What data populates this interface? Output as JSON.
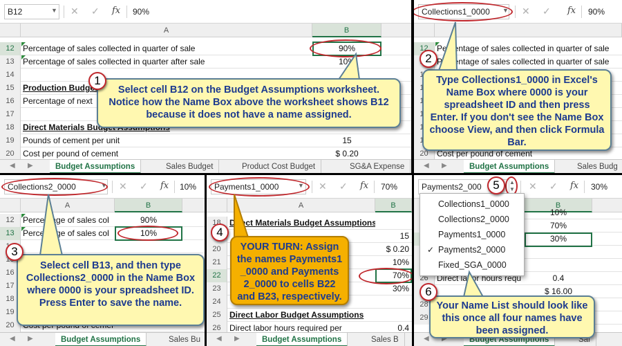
{
  "panel1": {
    "namebox": "B12",
    "formula": "90%",
    "col_a": "A",
    "col_b": "B",
    "rows": [
      {
        "n": "12",
        "a": "Percentage of sales collected in quarter of sale",
        "b": "90%",
        "bold": false
      },
      {
        "n": "13",
        "a": "Percentage of sales collected in quarter after sale",
        "b": "10%",
        "bold": false
      },
      {
        "n": "14",
        "a": "",
        "b": "",
        "bold": false
      },
      {
        "n": "15",
        "a": "Production Budget",
        "b": "",
        "bold": true
      },
      {
        "n": "16",
        "a": "Percentage of next",
        "b": "",
        "bold": false
      },
      {
        "n": "17",
        "a": "",
        "b": "",
        "bold": false
      },
      {
        "n": "18",
        "a": "Direct Materials Budget Assumptions",
        "b": "",
        "bold": true
      },
      {
        "n": "19",
        "a": "Pounds of cement per unit",
        "b": "15",
        "bold": false
      },
      {
        "n": "20",
        "a": "Cost per pound of cement",
        "b": "$         0.20",
        "bold": false
      }
    ],
    "tabs": [
      "Budget Assumptions",
      "Sales Budget",
      "Product Cost Budget",
      "SG&A Expense"
    ],
    "callout_num": "1",
    "callout": "Select cell B12 on the Budget Assumptions worksheet. Notice how the Name Box above the worksheet shows B12 because it does not have a name assigned."
  },
  "panel2": {
    "namebox": "Collections1_0000",
    "formula": "90%",
    "rows": [
      {
        "n": "12",
        "a": "Percentage of sales collected in quarter of sale"
      },
      {
        "n": "13",
        "a": "Percentage of sales collected in quarter of sale"
      },
      {
        "n": "14",
        "a": ""
      },
      {
        "n": "15",
        "a": ""
      },
      {
        "n": "16",
        "a": ""
      },
      {
        "n": "17",
        "a": ""
      },
      {
        "n": "18",
        "a": ""
      },
      {
        "n": "19",
        "a": ""
      },
      {
        "n": "20",
        "a": "Cost per pound of cement"
      }
    ],
    "tabs": [
      "Budget Assumptions",
      "Sales Budg"
    ],
    "callout_num": "2",
    "callout": "Type Collections1_0000 in Excel's Name Box where 0000 is your spreadsheet ID and then press Enter. If you don't see the Name Box choose View, and then click Formula Bar."
  },
  "panel3": {
    "namebox": "Collections2_0000",
    "formula": "10%",
    "col_a": "A",
    "col_b": "B",
    "rows": [
      {
        "n": "12",
        "a": "Percentage of sales col",
        "b": "90%"
      },
      {
        "n": "13",
        "a": "Percentage of sales col",
        "b": "10%"
      },
      {
        "n": "14",
        "a": "",
        "b": ""
      },
      {
        "n": "15",
        "a": "",
        "b": ""
      },
      {
        "n": "16",
        "a": "",
        "b": ""
      },
      {
        "n": "17",
        "a": "",
        "b": ""
      },
      {
        "n": "18",
        "a": "",
        "b": ""
      },
      {
        "n": "19",
        "a": "",
        "b": ""
      },
      {
        "n": "20",
        "a": "Cost per pound of cement",
        "b": ""
      }
    ],
    "tabs": [
      "Budget Assumptions",
      "Sales Bu"
    ],
    "callout_num": "3",
    "callout": "Select cell B13, and then type Collections2_0000 in the Name Box where 0000 is your spreadsheet ID. Press Enter to save the name."
  },
  "panel4": {
    "namebox": "Payments1_0000",
    "formula": "70%",
    "col_a": "A",
    "col_b": "B",
    "rows": [
      {
        "n": "18",
        "a": "Direct Materials Budget Assumptions",
        "b": "",
        "bold": true
      },
      {
        "n": "19",
        "a": "",
        "b": "15",
        "bold": false
      },
      {
        "n": "20",
        "a": "",
        "b": "$      0.20",
        "bold": false
      },
      {
        "n": "21",
        "a": "",
        "b": "10%",
        "bold": false
      },
      {
        "n": "22",
        "a": "",
        "b": "70%",
        "bold": false
      },
      {
        "n": "23",
        "a": "",
        "b": "30%",
        "bold": false
      },
      {
        "n": "24",
        "a": "",
        "b": "",
        "bold": false
      },
      {
        "n": "25",
        "a": "Direct Labor Budget Assumptions",
        "b": "",
        "bold": true
      },
      {
        "n": "26",
        "a": "Direct labor hours required per",
        "b": "0.4",
        "bold": false
      }
    ],
    "tabs": [
      "Budget Assumptions",
      "Sales B"
    ],
    "callout_num": "4",
    "callout": "YOUR TURN: Assign the names Payments1 _0000 and Payments 2_0000 to cells B22 and B23, respectively."
  },
  "panel5": {
    "namebox": "Payments2_000",
    "formula": "30%",
    "col_b": "B",
    "rows": [
      {
        "n": "21",
        "a": "",
        "b": "10%",
        "bold": false
      },
      {
        "n": "22",
        "a": "",
        "b": "70%",
        "bold": false
      },
      {
        "n": "23",
        "a": "",
        "b": "30%",
        "bold": false
      },
      {
        "n": "24",
        "a": "",
        "b": "",
        "bold": false
      },
      {
        "n": "25",
        "a": "ssumptions",
        "b": "",
        "bold": true
      },
      {
        "n": "26",
        "a": "Direct labor hours requ",
        "b": "0.4",
        "bold": false
      },
      {
        "n": "27",
        "a": "",
        "b": "$      16.00",
        "bold": false
      },
      {
        "n": "28",
        "a": "",
        "b": "",
        "bold": false
      },
      {
        "n": "29",
        "a": "",
        "b": "",
        "bold": false
      }
    ],
    "dropdown": [
      {
        "label": "Collections1_0000",
        "checked": false
      },
      {
        "label": "Collections2_0000",
        "checked": false
      },
      {
        "label": "Payments1_0000",
        "checked": false
      },
      {
        "label": "Payments2_0000",
        "checked": true
      },
      {
        "label": "Fixed_SGA_0000",
        "checked": false
      }
    ],
    "tabs": [
      "Budget Assumptions",
      "Sal"
    ],
    "callout_num_5": "5",
    "callout_num": "6",
    "callout": "Your Name List should look like this once all four names have been assigned."
  },
  "colors": {
    "excel_green": "#217346",
    "callout_yellow": "#fff8b0",
    "callout_orange": "#f5b000",
    "annotation_red": "#c0282d",
    "callout_text": "#1d3b8f"
  }
}
